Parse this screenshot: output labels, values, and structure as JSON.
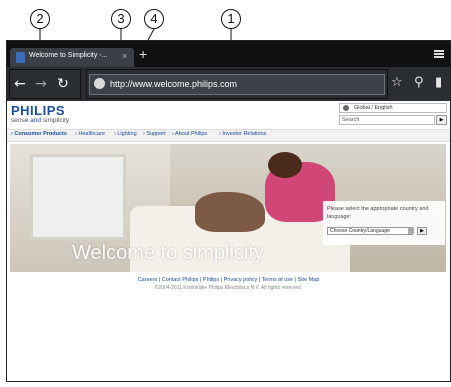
{
  "callouts": [
    "2",
    "3",
    "4",
    "1"
  ],
  "browser": {
    "tab_title": "Welcome to Simplicity -...",
    "tab_close": "×",
    "new_tab": "+",
    "url": "http://www.welcome.philips.com"
  },
  "site": {
    "logo": "PHILIPS",
    "tagline_a": "sense ",
    "tagline_b": "and",
    "tagline_c": " simplicity",
    "region": "Global / English",
    "search_placeholder": "Search",
    "nav": [
      "› Consumer Products",
      "› Healthcare",
      "› Lighting",
      "› Support",
      "› About Philips",
      "› Investor Relations"
    ],
    "hero_title": "Welcome to simplicity",
    "choose_text": "Please select the appropriate country and language:",
    "choose_select": "Choose Country/Language",
    "footer_links": "Careers | Contact Philips | Philips | Privacy policy | Terms of use | Site Map",
    "footer_copy": "©2004-2011 Koninklijke Philips Electronics N.V. All rights reserved."
  }
}
